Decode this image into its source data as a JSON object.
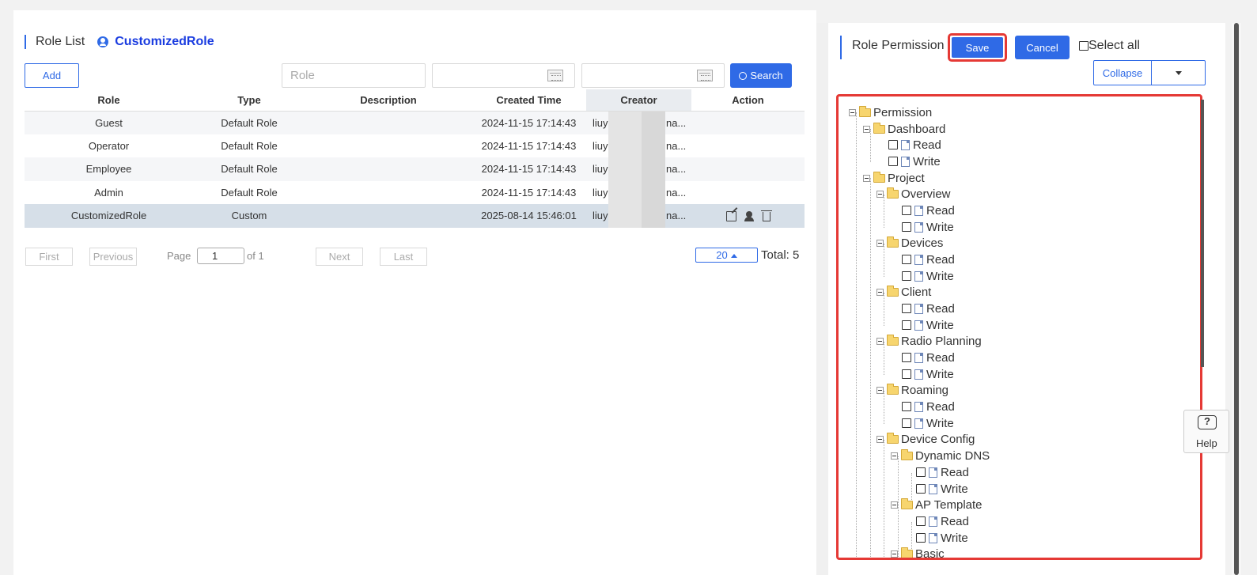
{
  "left": {
    "title": "Role List",
    "selected_role": "CustomizedRole",
    "add_label": "Add",
    "role_placeholder": "Role",
    "search_label": "Search",
    "columns": [
      "Role",
      "Type",
      "Description",
      "Created Time",
      "Creator",
      "Action"
    ],
    "rows": [
      {
        "role": "Guest",
        "type": "Default Role",
        "description": "",
        "created": "2024-11-15 17:14:43",
        "creator": "liuyij",
        "creator_tail": "na..."
      },
      {
        "role": "Operator",
        "type": "Default Role",
        "description": "",
        "created": "2024-11-15 17:14:43",
        "creator": "liuyij",
        "creator_tail": "na..."
      },
      {
        "role": "Employee",
        "type": "Default Role",
        "description": "",
        "created": "2024-11-15 17:14:43",
        "creator": "liuyij",
        "creator_tail": "na..."
      },
      {
        "role": "Admin",
        "type": "Default Role",
        "description": "",
        "created": "2024-11-15 17:14:43",
        "creator": "liuyij",
        "creator_tail": "na..."
      },
      {
        "role": "CustomizedRole",
        "type": "Custom",
        "description": "",
        "created": "2025-08-14 15:46:01",
        "creator": "liuyij",
        "creator_tail": "na..."
      }
    ],
    "pager": {
      "first": "First",
      "previous": "Previous",
      "page_label": "Page",
      "page_value": "1",
      "of_label": "of 1",
      "next": "Next",
      "last": "Last",
      "page_size": "20",
      "total": "Total: 5"
    }
  },
  "right": {
    "title": "Role Permission",
    "save": "Save",
    "cancel": "Cancel",
    "select_all": "Select all",
    "collapse": "Collapse",
    "tree": {
      "root": "Permission",
      "dashboard": "Dashboard",
      "project": "Project",
      "overview": "Overview",
      "devices": "Devices",
      "client": "Client",
      "radio_planning": "Radio Planning",
      "roaming": "Roaming",
      "device_config": "Device Config",
      "dynamic_dns": "Dynamic DNS",
      "ap_template": "AP Template",
      "basic": "Basic",
      "read": "Read",
      "write": "Write"
    }
  },
  "help_label": "Help",
  "colors": {
    "accent": "#2f6ae6",
    "highlight": "#e53935",
    "role_name": "#1a3ce0"
  }
}
